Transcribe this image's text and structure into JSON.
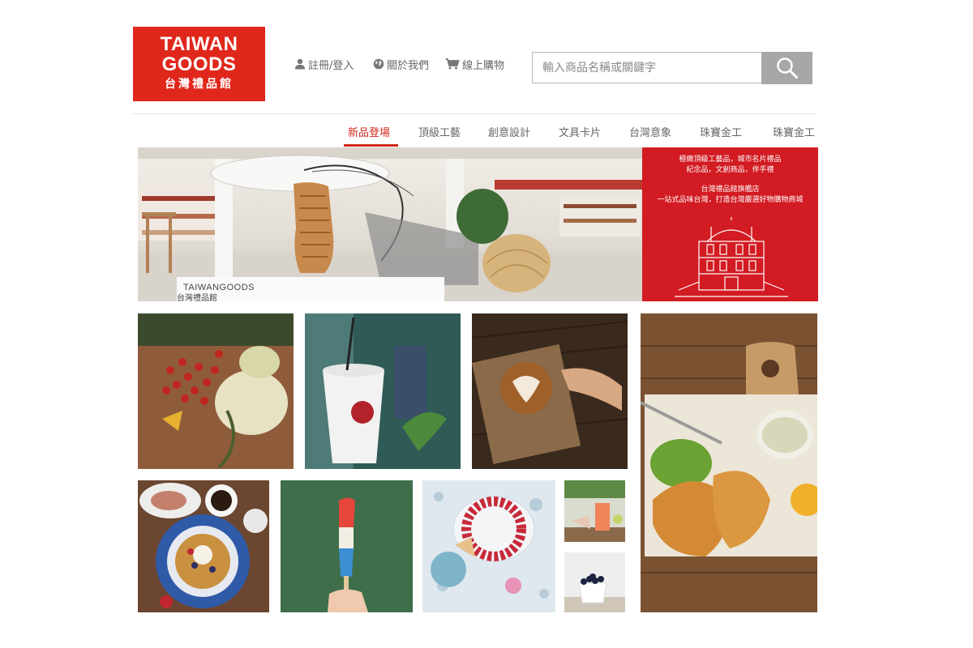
{
  "brand": {
    "line1": "TAIWAN",
    "line2": "GOODS",
    "line3": "台灣禮品館",
    "color": "#e0271b"
  },
  "header": {
    "links": [
      {
        "label": "註冊/登入",
        "icon": "user-icon"
      },
      {
        "label": "關於我們",
        "icon": "globe-icon"
      },
      {
        "label": "線上購物",
        "icon": "cart-icon"
      }
    ],
    "search": {
      "placeholder": "輸入商品名稱或關鍵字",
      "value": "",
      "button_icon": "search-icon"
    }
  },
  "nav": {
    "active_color": "#d2281e",
    "tabs": [
      {
        "label": "新品登場",
        "active": true
      },
      {
        "label": "頂級工藝",
        "active": false
      },
      {
        "label": "創意設計",
        "active": false
      },
      {
        "label": "文具卡片",
        "active": false
      },
      {
        "label": "台灣意象",
        "active": false
      },
      {
        "label": "珠寶金工",
        "active": false
      },
      {
        "label": "珠寶金工",
        "active": false
      }
    ]
  },
  "hero": {
    "photo_brand": "TAIWANGOODS",
    "photo_brand_cn": "台灣禮品館",
    "panel_color": "#d21b22",
    "panel_lines": [
      "極緻頂級工藝品，城市名片禮品",
      "紀念品，文創商品，伴手禮",
      "台灣禮品館旗艦店",
      "一站式品味台灣，打造台灣嚴選好物購物商城"
    ]
  },
  "tiles": [
    {
      "icon": "berries-flowers-photo"
    },
    {
      "icon": "coffee-cup-photo"
    },
    {
      "icon": "latte-art-photo"
    },
    {
      "icon": "fish-and-chips-photo"
    },
    {
      "icon": "waffle-breakfast-photo"
    },
    {
      "icon": "popsicle-photo"
    },
    {
      "icon": "raspberry-cake-photo"
    },
    {
      "icon": "smoothie-photo"
    },
    {
      "icon": "blueberries-photo"
    }
  ]
}
